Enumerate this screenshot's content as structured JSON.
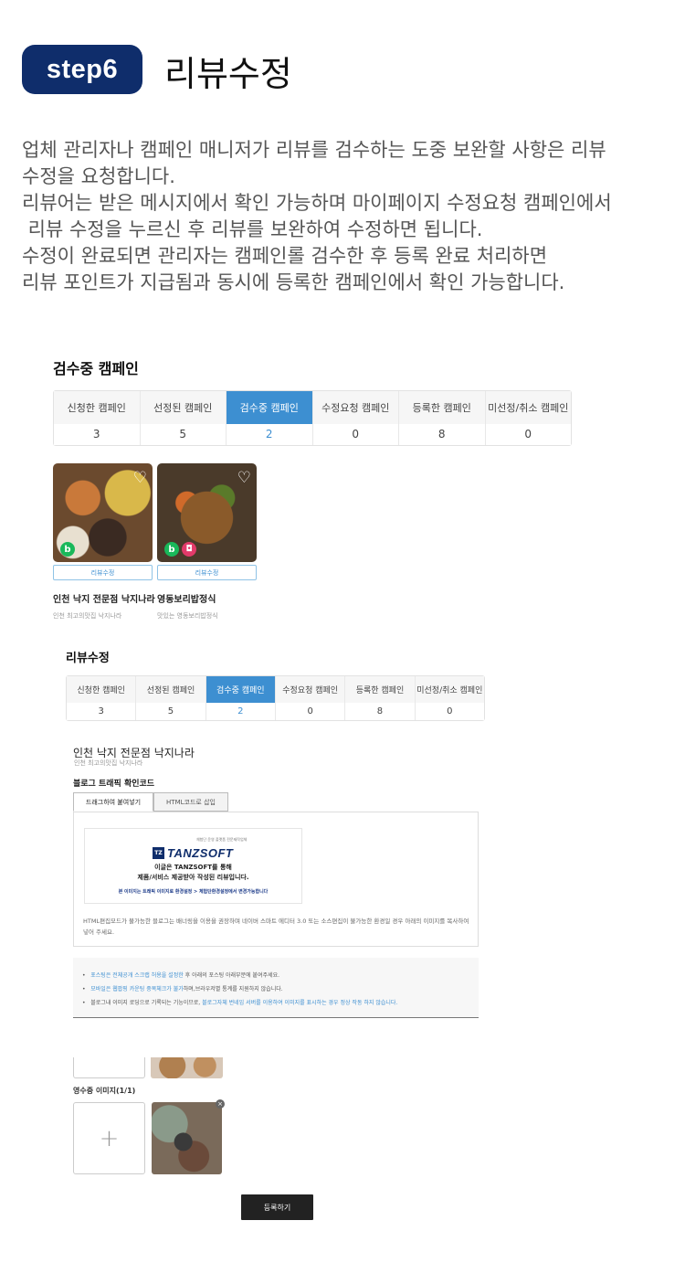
{
  "header": {
    "step_label": "step6",
    "title": "리뷰수정"
  },
  "description": [
    "업체 관리자나 캠페인 매니저가 리뷰를 검수하는 도중 보완할 사항은 리뷰",
    "수정을 요청합니다.",
    "리뷰어는 받은 메시지에서 확인 가능하며 마이페이지 수정요청 캠페인에서",
    " 리뷰 수정을 누르신 후 리뷰를 보완하여 수정하면 됩니다.",
    "수정이 완료되면 관리자는 캠페인롤 검수한 후 등록 완료 처리하면",
    "리뷰 포인트가 지급됨과 동시에 등록한 캠페인에서 확인 가능합니다."
  ],
  "section1": {
    "title": "검수중 캠페인",
    "tabs": [
      {
        "label": "신청한 캠페인",
        "count": "3"
      },
      {
        "label": "선정된 캠페인",
        "count": "5"
      },
      {
        "label": "검수중 캠페인",
        "count": "2"
      },
      {
        "label": "수정요청 캠페인",
        "count": "0"
      },
      {
        "label": "등록한 캠페인",
        "count": "8"
      },
      {
        "label": "미선정/취소 캠페인",
        "count": "0"
      }
    ],
    "active_tab": 2,
    "cards": [
      {
        "button": "리뷰수정",
        "name": "인천 낙지 전문점 낙지나라",
        "sub": "인천 최고의맛집 낙지나라",
        "badges": [
          "b"
        ]
      },
      {
        "button": "리뷰수정",
        "name": "영동보리밥정식",
        "sub": "맛있는 영동보리밥정식",
        "badges": [
          "b",
          "bag"
        ]
      }
    ]
  },
  "section2": {
    "title": "리뷰수정",
    "tabs": [
      {
        "label": "신청한 캠페인",
        "count": "3"
      },
      {
        "label": "선정된 캠페인",
        "count": "5"
      },
      {
        "label": "검수중 캠페인",
        "count": "2"
      },
      {
        "label": "수정요청 캠페인",
        "count": "0"
      },
      {
        "label": "등록한 캠페인",
        "count": "8"
      },
      {
        "label": "미선정/취소 캠페인",
        "count": "0"
      }
    ],
    "detail_title": "인천 낙지 전문점 낙지나라",
    "detail_sub": "인천 최고의맛집 낙지나라",
    "code_title": "블로그 트래픽 확인코드",
    "subtabs": [
      "드래그하여 붙여넣기",
      "HTML코드로 삽입"
    ],
    "banner": {
      "tag": "체험단 운영 플랫폼 전문제작업체",
      "logo_mark": "TZ",
      "logo_text": "TANZSOFT",
      "line1": "이글은 TANZSOFT를 통해",
      "line2": "제품/서비스 제공받아 작성된 리뷰입니다.",
      "line3": "본 이미지는 트래픽 이미지로 환경설정 > 체험단환경설정에서 변경가능합니다"
    },
    "code_note": "HTML편집모드가 불가능한 블로그는 배너링을 이용을 권장하며 네이버 스마트 에디터 3.0 또는 소스편집이 불가능한 환경일 경우 아래의 이미지를 복사하여 넣어 주세요.",
    "notes": [
      {
        "hl": "포스팅은 전체공개 스크랩 허용을 설정한",
        "rest": " 후 아래의 포스팅 아래부분에 붙여주세요."
      },
      {
        "hl": "모바일은 웹팝핑 카운팅 중복체크가 불가",
        "rest": "하며,브라우저별 통계를 지원하지 않습니다."
      },
      {
        "pre": "블로그내 이미지 로딩으로 기록되는 기능이므로, ",
        "hl": "블로그자체 번네임 서버를 이용하여 이미지를 표시하는 경우 정상 작동 하지 않습니다."
      }
    ],
    "receipt_title": "영수증 이미지(1/1)",
    "upload_icon": "+",
    "remove_icon": "×",
    "submit_label": "등록하기"
  },
  "colors": {
    "brand_navy": "#0f2d6b",
    "tab_active": "#3d8fd1",
    "submit": "#222222"
  }
}
